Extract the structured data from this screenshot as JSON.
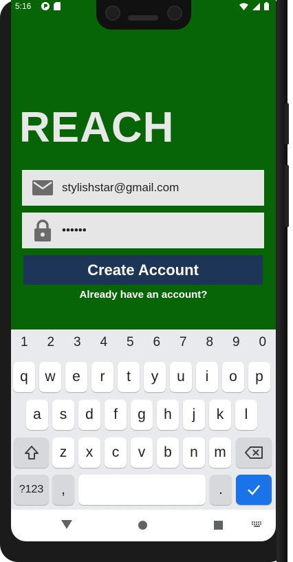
{
  "status_bar": {
    "time": "5:16"
  },
  "app": {
    "title": "REACH",
    "email_value": "stylishstar@gmail.com",
    "password_value": "••••••",
    "create_button_label": "Create Account",
    "login_link_label": "Already have an account?"
  },
  "keyboard": {
    "number_row": [
      "1",
      "2",
      "3",
      "4",
      "5",
      "6",
      "7",
      "8",
      "9",
      "0"
    ],
    "row1": [
      "q",
      "w",
      "e",
      "r",
      "t",
      "y",
      "u",
      "i",
      "o",
      "p"
    ],
    "row2": [
      "a",
      "s",
      "d",
      "f",
      "g",
      "h",
      "j",
      "k",
      "l"
    ],
    "row3": [
      "z",
      "x",
      "c",
      "v",
      "b",
      "n",
      "m"
    ],
    "symbols_label": "?123",
    "comma_label": ",",
    "period_label": "."
  },
  "colors": {
    "background": "#076506",
    "button": "#1d3556",
    "field": "#e6e6e6",
    "enter_key": "#1a73e8"
  }
}
